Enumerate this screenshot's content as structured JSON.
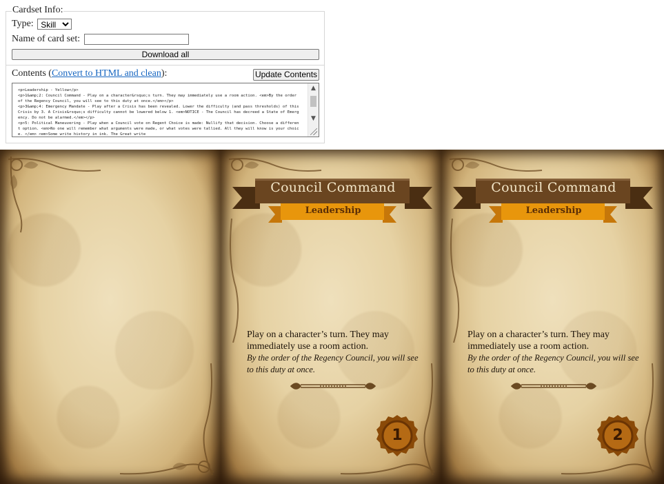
{
  "form": {
    "legend": "Cardset Info:",
    "type_label": "Type:",
    "type_value": "Skill",
    "type_options": [
      "Skill"
    ],
    "name_label": "Name of card set:",
    "name_value": "",
    "download_label": "Download all",
    "contents_label_prefix": "Contents (",
    "contents_link": "Convert to HTML and clean",
    "contents_label_suffix": "):",
    "update_label": "Update Contents",
    "contents_text": "<p>Leadership - Yellow</p>\n<p>1&amp;2: Council Command - Play on a character&rsquo;s turn. They may immediately use a room action. <em>By the order of the Regency Council, you will see to this duty at once.</em></p>\n<p>3&amp;4: Emergency Mandate - Play after a Crisis has been revealed. Lower the difficulty (and pass thresholds) of this Crisis by 3. A Crisis&rsquo;s difficulty cannot be lowered below 1. <em>NOTICE - The Council has decreed a State of Emergency. Do not be alarmed.</em></p>\n<p>5: Political Maneuvering - Play when a Council vote on Regent Choice is made: Nullify that decision. Choose a different option. <em>No one will remember what arguments were made, or what votes were tallied. All they will know is your choice. </em> <em>Some write history in ink. The Great write"
  },
  "colors": {
    "banner_dark": "#5a3a1a",
    "banner_gold": "#e8960c",
    "parchment": "#e6d2a4",
    "seal": "#8a4a08"
  },
  "cards": [
    {
      "title": "Council Command",
      "subtitle": "Leadership",
      "text": "Play on a character’s turn. They may immediately use a room action.",
      "flavor": "By the order of the Regency Council, you will see to this duty at once.",
      "number": "1"
    },
    {
      "title": "Council Command",
      "subtitle": "Leadership",
      "text": "Play on a character’s turn. They may immediately use a room action.",
      "flavor": "By the order of the Regency Council, you will see to this duty at once.",
      "number": "2"
    }
  ]
}
